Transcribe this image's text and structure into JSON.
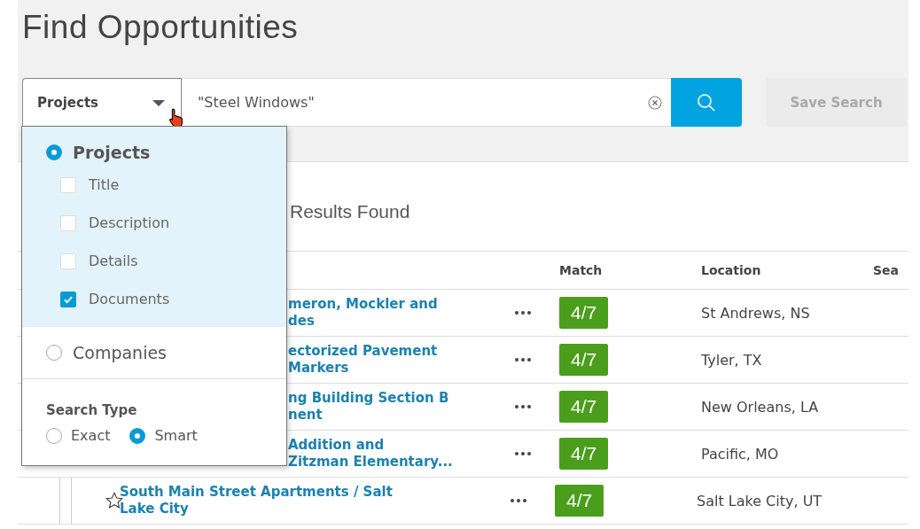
{
  "page_title": "Find Opportunities",
  "search": {
    "scope": "Projects",
    "value": "\"Steel Windows\"",
    "save_button": {
      "label": "Save Search",
      "disabled": true
    }
  },
  "results_heading": "Results Found",
  "table": {
    "columns": [
      "Match",
      "Location",
      "Sea"
    ],
    "rows": [
      {
        "kind": "partial",
        "title": "meron, Mockler and\ndes",
        "match": "4/7",
        "location": "St Andrews, NS"
      },
      {
        "kind": "partial",
        "title": "ectorized Pavement\nMarkers",
        "match": "4/7",
        "location": "Tyler, TX"
      },
      {
        "kind": "partial",
        "title": "ng Building Section B\nnent",
        "match": "4/7",
        "location": "New Orleans, LA"
      },
      {
        "kind": "partial",
        "title": "Addition and\nZitzman Elementary...",
        "match": "4/7",
        "location": "Pacific, MO"
      },
      {
        "kind": "full",
        "title": "South Main Street Apartments / Salt\nLake City",
        "match": "4/7",
        "location": "Salt Lake City, UT"
      }
    ]
  },
  "dropdown": {
    "options": [
      {
        "label": "Projects",
        "selected": true,
        "fields": [
          {
            "label": "Title",
            "checked": false
          },
          {
            "label": "Description",
            "checked": false
          },
          {
            "label": "Details",
            "checked": false
          },
          {
            "label": "Documents",
            "checked": true
          }
        ]
      },
      {
        "label": "Companies",
        "selected": false
      }
    ],
    "search_type": {
      "label": "Search Type",
      "options": [
        {
          "label": "Exact",
          "selected": false
        },
        {
          "label": "Smart",
          "selected": true
        }
      ]
    }
  }
}
